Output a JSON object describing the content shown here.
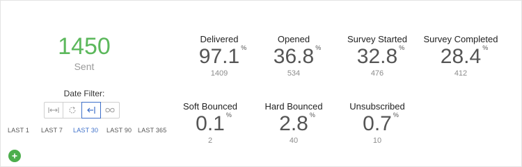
{
  "summary": {
    "sent_value": "1450",
    "sent_label": "Sent"
  },
  "date_filter": {
    "title": "Date Filter:",
    "buttons": [
      {
        "icon": "arrows-expand-icon"
      },
      {
        "icon": "refresh-icon"
      },
      {
        "icon": "arrow-left-bar-icon",
        "active": true
      },
      {
        "icon": "infinity-icon"
      }
    ],
    "ranges": [
      "LAST 1",
      "LAST 7",
      "LAST 30",
      "LAST 90",
      "LAST 365"
    ],
    "active_range": "LAST 30"
  },
  "stats": [
    {
      "label": "Delivered",
      "value": "97.1",
      "unit": "%",
      "count": "1409"
    },
    {
      "label": "Opened",
      "value": "36.8",
      "unit": "%",
      "count": "534"
    },
    {
      "label": "Survey Started",
      "value": "32.8",
      "unit": "%",
      "count": "476"
    },
    {
      "label": "Survey Completed",
      "value": "28.4",
      "unit": "%",
      "count": "412"
    },
    {
      "label": "Soft Bounced",
      "value": "0.1",
      "unit": "%",
      "count": "2"
    },
    {
      "label": "Hard Bounced",
      "value": "2.8",
      "unit": "%",
      "count": "40"
    },
    {
      "label": "Unsubscribed",
      "value": "0.7",
      "unit": "%",
      "count": "10"
    }
  ],
  "colors": {
    "sent": "#5cb85c",
    "active": "#3d6fc9",
    "add_button": "#4cae4c"
  },
  "add_button_icon": "plus-icon"
}
